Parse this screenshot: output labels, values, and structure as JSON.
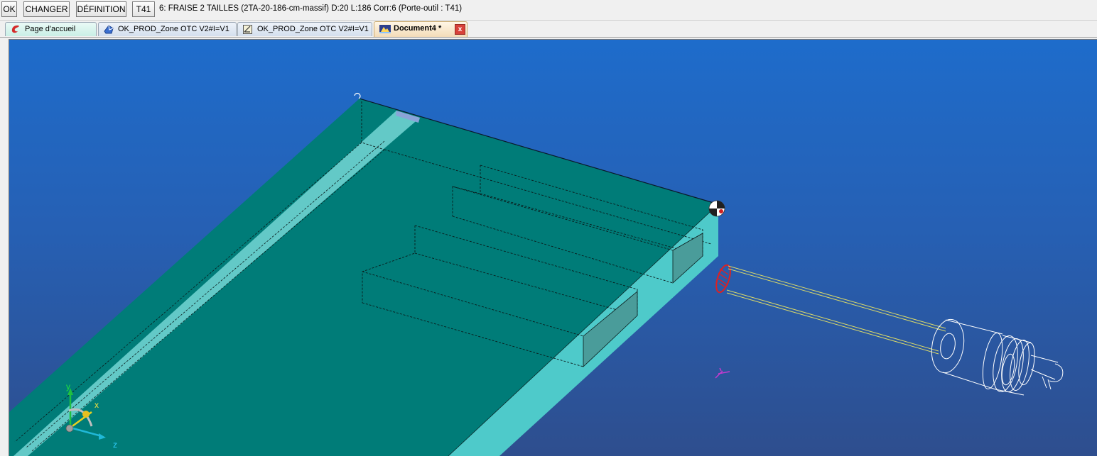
{
  "toolbar": {
    "ok_label": "OK",
    "changer_label": "CHANGER",
    "definition_label": "DÉFINITION",
    "tool_code": "T41",
    "tool_description": "6: FRAISE 2 TAILLES (2TA-20-186-cm-massif)  D:20  L:186  Corr:6  (Porte-outil : T41)"
  },
  "tabs": [
    {
      "label": "Page d'accueil",
      "icon": "home-logo-icon"
    },
    {
      "label": "OK_PROD_Zone OTC V2#I=V1",
      "icon": "part-icon"
    },
    {
      "label": "OK_PROD_Zone OTC V2#I=V1",
      "icon": "drawing-icon"
    },
    {
      "label": "Document4 *",
      "icon": "document-icon",
      "active": true
    }
  ],
  "close_label": "x",
  "axis_triad": {
    "y": "y",
    "x": "x",
    "z": "z"
  },
  "colors": {
    "viewport_top": "#1e6ccb",
    "viewport_bottom": "#2e4e8e",
    "part_top_face": "#007c78",
    "part_side_face": "#4ecaca",
    "tool_wireframe": "#ffffff",
    "tool_shank_lines": "#d8d86a",
    "tool_tip": "#e02020"
  }
}
